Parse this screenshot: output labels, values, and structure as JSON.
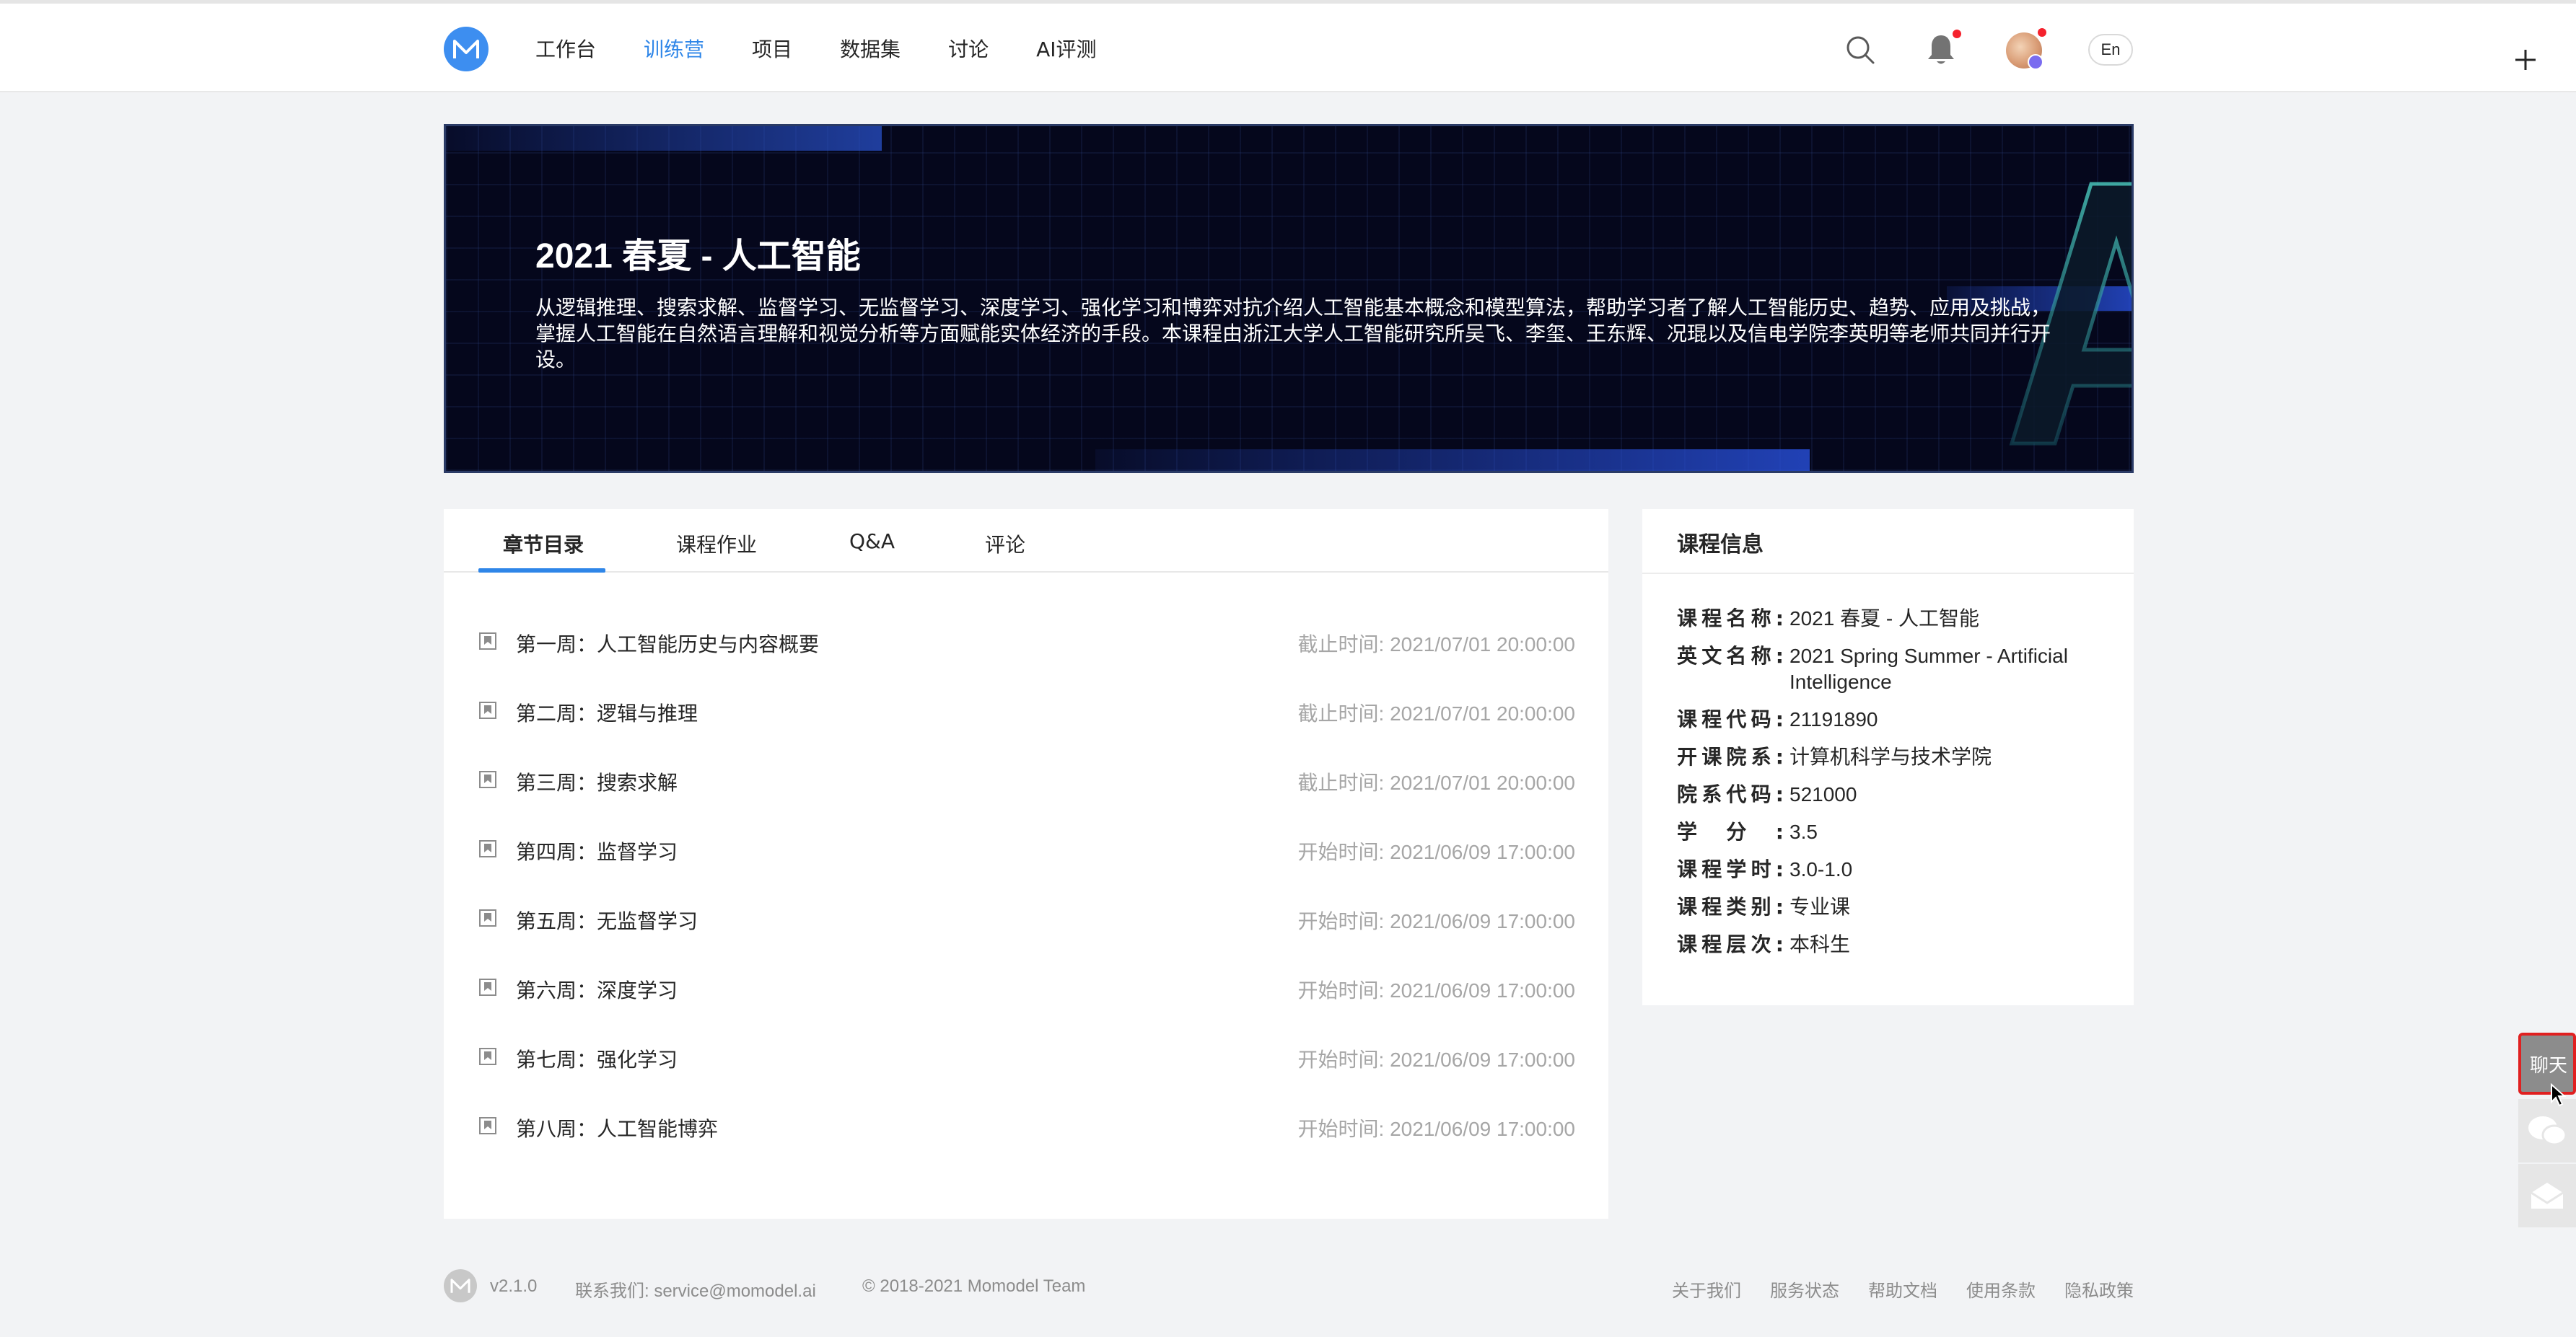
{
  "nav": {
    "logo_letter": "M",
    "items": [
      {
        "label": "工作台",
        "active": false
      },
      {
        "label": "训练营",
        "active": true
      },
      {
        "label": "项目",
        "active": false
      },
      {
        "label": "数据集",
        "active": false
      },
      {
        "label": "讨论",
        "active": false
      },
      {
        "label": "AI评测",
        "active": false
      }
    ],
    "lang_label": "En"
  },
  "banner": {
    "title": "2021 春夏 - 人工智能",
    "description": "从逻辑推理、搜索求解、监督学习、无监督学习、深度学习、强化学习和博弈对抗介绍人工智能基本概念和模型算法，帮助学习者了解人工智能历史、趋势、应用及挑战，掌握人工智能在自然语言理解和视觉分析等方面赋能实体经济的手段。本课程由浙江大学人工智能研究所吴飞、李玺、王东辉、况琨以及信电学院李英明等老师共同并行开设。"
  },
  "tabs": [
    {
      "label": "章节目录",
      "active": true
    },
    {
      "label": "课程作业",
      "active": false
    },
    {
      "label": "Q&A",
      "active": false
    },
    {
      "label": "评论",
      "active": false
    }
  ],
  "chapters": [
    {
      "title": "第一周：人工智能历史与内容概要",
      "time": "截止时间: 2021/07/01 20:00:00"
    },
    {
      "title": "第二周：逻辑与推理",
      "time": "截止时间: 2021/07/01 20:00:00"
    },
    {
      "title": "第三周：搜索求解",
      "time": "截止时间: 2021/07/01 20:00:00"
    },
    {
      "title": "第四周：监督学习",
      "time": "开始时间: 2021/06/09 17:00:00"
    },
    {
      "title": "第五周：无监督学习",
      "time": "开始时间: 2021/06/09 17:00:00"
    },
    {
      "title": "第六周：深度学习",
      "time": "开始时间: 2021/06/09 17:00:00"
    },
    {
      "title": "第七周：强化学习",
      "time": "开始时间: 2021/06/09 17:00:00"
    },
    {
      "title": "第八周：人工智能博弈",
      "time": "开始时间: 2021/06/09 17:00:00"
    }
  ],
  "course_info": {
    "title": "课程信息",
    "rows": [
      {
        "label": "课程名称:",
        "value": "2021 春夏 - 人工智能"
      },
      {
        "label": "英文名称:",
        "value": "2021 Spring Summer - Artificial Intelligence"
      },
      {
        "label": "课程代码:",
        "value": "21191890"
      },
      {
        "label": "开课院系:",
        "value": "计算机科学与技术学院"
      },
      {
        "label": "院系代码:",
        "value": "521000"
      },
      {
        "label": "学分:",
        "value": "3.5"
      },
      {
        "label": "课程学时:",
        "value": "3.0-1.0"
      },
      {
        "label": "课程类别:",
        "value": "专业课"
      },
      {
        "label": "课程层次:",
        "value": "本科生"
      }
    ]
  },
  "float_tools": {
    "chat_label": "聊天"
  },
  "footer": {
    "logo_letter": "M",
    "version": "v2.1.0",
    "contact": "联系我们: service@momodel.ai",
    "copyright": "© 2018-2021 Momodel Team",
    "links": [
      "关于我们",
      "服务状态",
      "帮助文档",
      "使用条款",
      "隐私政策"
    ]
  },
  "colors": {
    "accent": "#2f86e8",
    "banner_bg": "#05071c",
    "muted_text": "#a6a6a6",
    "chat_highlight": "#e02020"
  }
}
